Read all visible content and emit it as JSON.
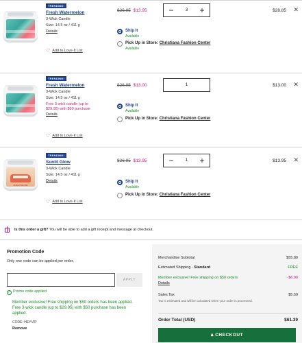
{
  "items": [
    {
      "badge": "TRENDING!",
      "name": "Fresh Watermelon",
      "type": "3-Wick Candle",
      "size": "Size: 14.5 oz / 411 g",
      "promo": "",
      "details": "Details",
      "love": "Add to Love-It List",
      "orig_price": "$26.95",
      "sale_price": "$13.95",
      "qty": "3",
      "has_stepper": true,
      "ship_label": "Ship It",
      "ship_avail": "Available",
      "pickup_label": "Pick Up in Store:",
      "pickup_store": "Christiana Fashion Center",
      "pickup_avail": "Available",
      "total": "$28.85"
    },
    {
      "badge": "TRENDING!",
      "name": "Fresh Watermelon",
      "type": "3-Wick Candle",
      "size": "Size: 14.5 oz / 411 g",
      "promo": "Free 3-wick candle (up to $29.95) with $50 purchase",
      "details": "Details",
      "love": "Add to Love-It List",
      "orig_price": "$26.95",
      "sale_price": "$13.00",
      "qty": "1",
      "has_stepper": false,
      "ship_label": "Ship It",
      "ship_avail": "Available",
      "pickup_label": "Pick Up in Store:",
      "pickup_store": "Christiana Fashion Center",
      "pickup_avail": "",
      "total": "$13.00"
    },
    {
      "badge": "TRENDING!",
      "name": "Sunlit Glow",
      "type": "3-Wick Candle",
      "size": "Size: 14.5 oz / 411 g",
      "promo": "",
      "details": "Details",
      "love": "Add to Love-It List",
      "orig_price": "$26.95",
      "sale_price": "$13.95",
      "qty": "1",
      "has_stepper": true,
      "ship_label": "Ship It",
      "ship_avail": "Available",
      "pickup_label": "Pick Up in Store:",
      "pickup_store": "Christiana Fashion Center",
      "pickup_avail": "",
      "total": "$13.95",
      "label_text": "SUNLIT GLOW"
    }
  ],
  "gift": {
    "question": "Is this order a gift?",
    "text": "You will be able to add a gift receipt and message at checkout."
  },
  "promo": {
    "title": "Promotion Code",
    "subtitle": "Only one code can be applied per order.",
    "input_value": "",
    "input_placeholder": "",
    "apply_label": "APPLY",
    "applied_text": "Promo code applied.",
    "message_1": "Member exclusive! Free shipping on $50 orders has been applied.",
    "message_2": "Free 3-wick candle (up to $29.95) with $50 purchase has been applied.",
    "code": "CODE: HEYVIP",
    "remove_label": "Remove"
  },
  "summary": {
    "subtotal_label": "Merchandise Subtotal",
    "subtotal_value": "$55.80",
    "shipping_label_a": "Estimated Shipping - ",
    "shipping_label_b": "Standard",
    "shipping_value": "FREE",
    "member_label": "Member exclusive! Free shipping on $50 orders",
    "member_value": "-$6.99",
    "details_link": "Details",
    "tax_label": "Sales Tax",
    "tax_value": "$5.59",
    "tax_note": "Tax is estimated and will be calculated when your order is processed.",
    "total_label": "Order Total (USD)",
    "total_value": "$61.39",
    "checkout_label": "CHECKOUT"
  },
  "colors": {
    "brand_blue": "#1a3d8a",
    "sale_magenta": "#c2187a",
    "available_green": "#1a8a2a",
    "checkout_green": "#17703b"
  }
}
